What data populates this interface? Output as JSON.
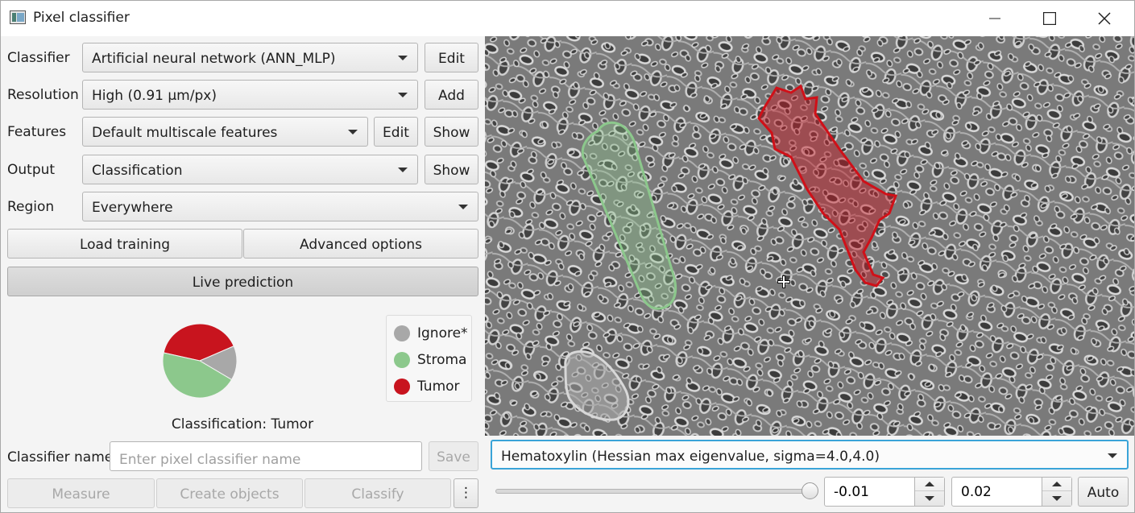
{
  "window": {
    "title": "Pixel classifier"
  },
  "form": {
    "classifier": {
      "label": "Classifier",
      "value": "Artificial neural network (ANN_MLP)",
      "button": "Edit"
    },
    "resolution": {
      "label": "Resolution",
      "value": "High (0.91 µm/px)",
      "button": "Add"
    },
    "features": {
      "label": "Features",
      "value": "Default multiscale features",
      "edit_button": "Edit",
      "show_button": "Show"
    },
    "output": {
      "label": "Output",
      "value": "Classification",
      "button": "Show"
    },
    "region": {
      "label": "Region",
      "value": "Everywhere"
    }
  },
  "buttons": {
    "load_training": "Load training",
    "advanced_options": "Advanced options",
    "live_prediction": "Live prediction",
    "save": "Save",
    "measure": "Measure",
    "create_objects": "Create objects",
    "classify": "Classify",
    "more": "⋮"
  },
  "pie": {
    "slices": [
      {
        "name": "Tumor",
        "color": "#c8141e",
        "fraction": 0.4
      },
      {
        "name": "Ignore*",
        "color": "#a8a8a8",
        "fraction": 0.15
      },
      {
        "name": "Stroma",
        "color": "#8cc88c",
        "fraction": 0.45
      }
    ]
  },
  "legend": [
    {
      "name": "Ignore*",
      "color": "#a8a8a8"
    },
    {
      "name": "Stroma",
      "color": "#8cc88c"
    },
    {
      "name": "Tumor",
      "color": "#c8141e"
    }
  ],
  "status": {
    "classification": "Classification: Tumor"
  },
  "classifier_name": {
    "label": "Classifier name",
    "placeholder": "Enter pixel classifier name",
    "value": ""
  },
  "viewer": {
    "channel": "Hematoxylin (Hessian max eigenvalue, sigma=4.0,4.0)",
    "min": "-0.01",
    "max": "0.02",
    "auto_button": "Auto"
  }
}
